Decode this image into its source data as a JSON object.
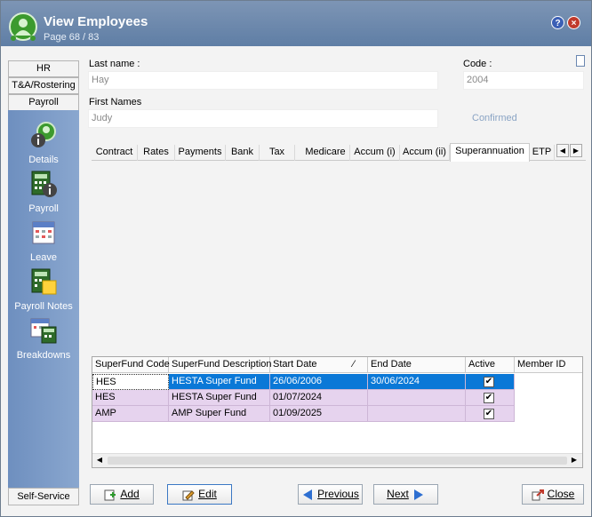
{
  "window": {
    "title": "View Employees",
    "subtitle": "Page 68 / 83",
    "help_label": "?",
    "close_label": "×"
  },
  "sidebar": {
    "tabs": [
      "HR",
      "T&A/Rostering",
      "Payroll"
    ],
    "items": [
      {
        "label": "Details",
        "icon": "user-info-icon"
      },
      {
        "label": "Payroll",
        "icon": "calculator-info-icon"
      },
      {
        "label": "Leave",
        "icon": "calendar-icon"
      },
      {
        "label": "Payroll Notes",
        "icon": "calculator-note-icon"
      },
      {
        "label": "Breakdowns",
        "icon": "calendar-calculator-icon"
      }
    ],
    "bottom_tab": "Self-Service"
  },
  "form": {
    "last_name_label": "Last name :",
    "last_name_value": "Hay",
    "first_names_label": "First Names",
    "first_names_value": "Judy",
    "code_label": "Code :",
    "code_value": "2004",
    "confirmed_label": "Confirmed"
  },
  "tabs": [
    "Contract",
    "Rates",
    "Payments",
    "Bank",
    "Tax",
    "Medicare",
    "Accum (i)",
    "Accum (ii)",
    "Superannuation",
    "ETP"
  ],
  "active_tab": "Superannuation",
  "grid": {
    "columns": [
      "SuperFund Code",
      "SuperFund Description",
      "Start Date",
      "End Date",
      "Active",
      "Member ID"
    ],
    "sort_indicator": "⁄",
    "rows": [
      {
        "code": "HES",
        "description": "HESTA Super Fund",
        "start": "26/06/2006",
        "end": "30/06/2024",
        "active": "✔",
        "member": ""
      },
      {
        "code": "HES",
        "description": "HESTA Super Fund",
        "start": "01/07/2024",
        "end": "",
        "active": "✔",
        "member": ""
      },
      {
        "code": "AMP",
        "description": "AMP Super Fund",
        "start": "01/09/2025",
        "end": "",
        "active": "✔",
        "member": ""
      }
    ]
  },
  "buttons": {
    "add": "Add",
    "edit": "Edit",
    "previous": "Previous",
    "next": "Next",
    "close": "Close"
  },
  "colors": {
    "selected_row": "#0a78d7",
    "alt_row": "#e6d3ee",
    "accent": "#6e8fbf"
  }
}
